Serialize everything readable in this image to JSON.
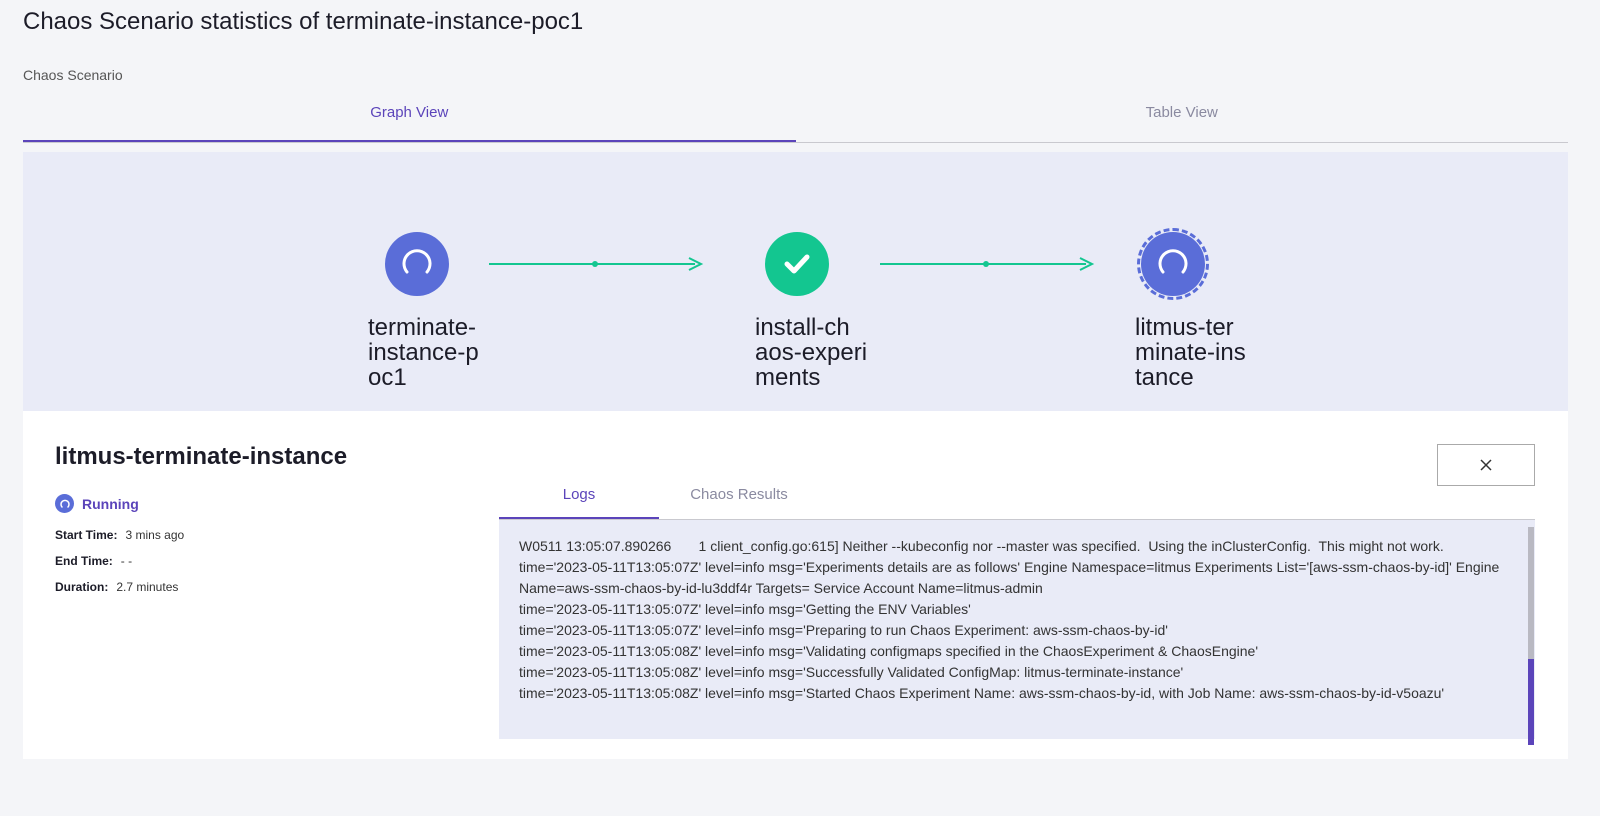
{
  "header": {
    "title": "Chaos Scenario statistics of terminate-instance-poc1",
    "subtitle": "Chaos Scenario"
  },
  "tabs": [
    {
      "label": "Graph View",
      "active": true
    },
    {
      "label": "Table View",
      "active": false
    }
  ],
  "graph": {
    "nodes": [
      {
        "label": "terminate-\ninstance-p\noc1",
        "status": "running",
        "icon": "spinner-icon"
      },
      {
        "label": "install-ch\naos-experi\nments",
        "status": "success",
        "icon": "check-icon"
      },
      {
        "label": "litmus-ter\nminate-ins\ntance",
        "status": "running-selected",
        "icon": "spinner-icon"
      }
    ]
  },
  "details": {
    "title": "litmus-terminate-instance",
    "status": "Running",
    "start_label": "Start Time:",
    "start_value": "3 mins ago",
    "end_label": "End Time:",
    "end_value": "- -",
    "duration_label": "Duration:",
    "duration_value": "2.7 minutes"
  },
  "sub_tabs": [
    {
      "label": "Logs",
      "active": true
    },
    {
      "label": "Chaos Results",
      "active": false
    }
  ],
  "logs": [
    "W0511 13:05:07.890266       1 client_config.go:615] Neither --kubeconfig nor --master was specified.  Using the inClusterConfig.  This might not work.",
    "time='2023-05-11T13:05:07Z' level=info msg='Experiments details are as follows' Engine Namespace=litmus Experiments List='[aws-ssm-chaos-by-id]' Engine Name=aws-ssm-chaos-by-id-lu3ddf4r Targets= Service Account Name=litmus-admin",
    "time='2023-05-11T13:05:07Z' level=info msg='Getting the ENV Variables'",
    "time='2023-05-11T13:05:07Z' level=info msg='Preparing to run Chaos Experiment: aws-ssm-chaos-by-id'",
    "time='2023-05-11T13:05:08Z' level=info msg='Validating configmaps specified in the ChaosExperiment & ChaosEngine'",
    "time='2023-05-11T13:05:08Z' level=info msg='Successfully Validated ConfigMap: litmus-terminate-instance'",
    "time='2023-05-11T13:05:08Z' level=info msg='Started Chaos Experiment Name: aws-ssm-chaos-by-id, with Job Name: aws-ssm-chaos-by-id-v5oazu'"
  ],
  "colors": {
    "accent": "#5b44ba",
    "running": "#5a6dd8",
    "success": "#13c690"
  }
}
